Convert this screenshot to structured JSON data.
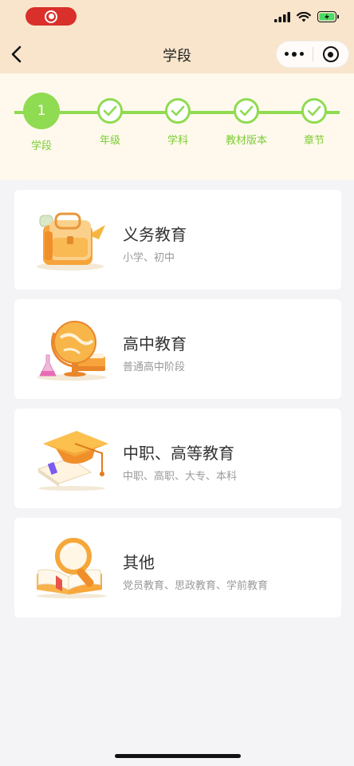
{
  "nav": {
    "title": "学段"
  },
  "steps": [
    {
      "label": "学段",
      "number": "1",
      "state": "active"
    },
    {
      "label": "年级",
      "state": "done"
    },
    {
      "label": "学科",
      "state": "done"
    },
    {
      "label": "教材版本",
      "state": "done"
    },
    {
      "label": "章节",
      "state": "done"
    }
  ],
  "cards": [
    {
      "title": "义务教育",
      "subtitle": "小学、初中",
      "icon": "backpack-icon"
    },
    {
      "title": "高中教育",
      "subtitle": "普通高中阶段",
      "icon": "globe-icon"
    },
    {
      "title": "中职、高等教育",
      "subtitle": "中职、高职、大专、本科",
      "icon": "graduation-cap-icon"
    },
    {
      "title": "其他",
      "subtitle": "党员教育、思政教育、学前教育",
      "icon": "magnifier-book-icon"
    }
  ],
  "colors": {
    "header_bg": "#f8e5cc",
    "steps_bg": "#fef9ec",
    "accent_green": "#8fdb51",
    "page_bg": "#f4f3f6"
  }
}
